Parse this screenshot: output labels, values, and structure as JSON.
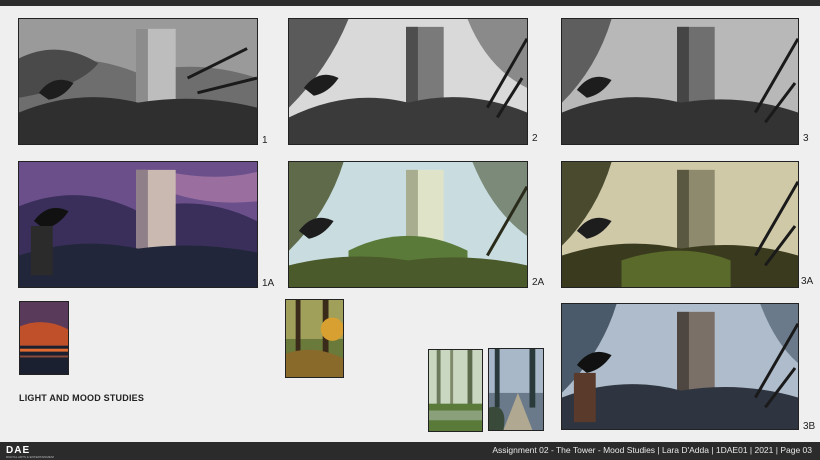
{
  "studies": [
    {
      "label": "1",
      "style": "bw"
    },
    {
      "label": "2",
      "style": "bw-light"
    },
    {
      "label": "3",
      "style": "bw"
    },
    {
      "label": "1A",
      "style": "purple"
    },
    {
      "label": "2A",
      "style": "green-light"
    },
    {
      "label": "3A",
      "style": "olive"
    },
    {
      "label": "3B",
      "style": "cool-blue"
    }
  ],
  "references": [
    {
      "name": "sunset-lake-reference"
    },
    {
      "name": "autumn-forest-reference"
    },
    {
      "name": "swamp-forest-reference"
    },
    {
      "name": "misty-path-reference"
    }
  ],
  "section_title": "LIGHT AND MOOD STUDIES",
  "footer": {
    "logo_text": "DAE",
    "logo_subtext": "DIGITAL ARTS & ENTERTAINMENT",
    "info": "Assignment  02 - The Tower - Mood Studies | Lara D'Adda | 1DAE01 | 2021 | Page 03"
  }
}
